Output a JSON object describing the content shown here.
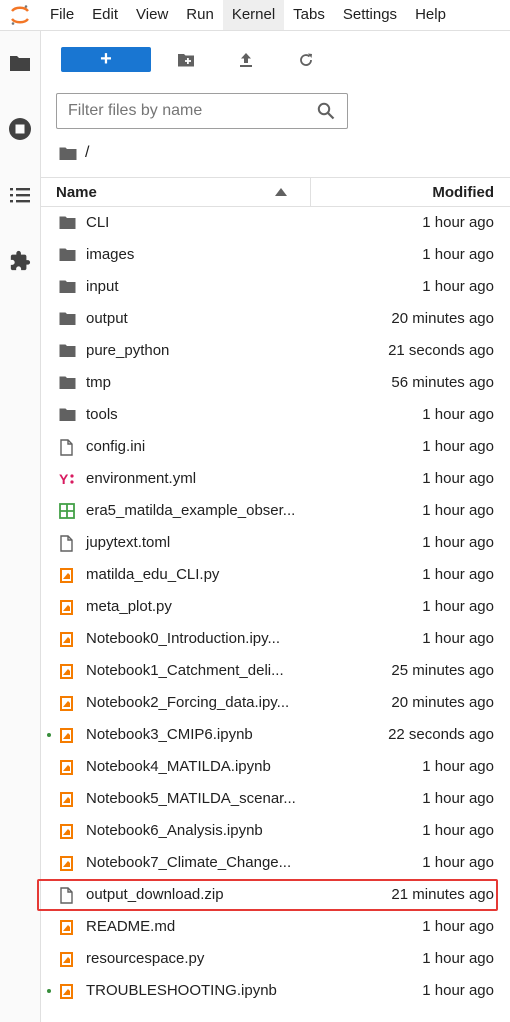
{
  "menubar": {
    "items": [
      "File",
      "Edit",
      "View",
      "Run",
      "Kernel",
      "Tabs",
      "Settings",
      "Help"
    ],
    "active": "Kernel"
  },
  "sidebar": {
    "tabs": [
      "folder-icon",
      "running-icon",
      "toc-icon",
      "extension-icon"
    ]
  },
  "toolbar": {
    "new_label": "+",
    "new_folder_icon": "new-folder-icon",
    "upload_icon": "upload-icon",
    "refresh_icon": "refresh-icon"
  },
  "filter": {
    "placeholder": "Filter files by name",
    "value": ""
  },
  "breadcrumb": {
    "path": "/"
  },
  "columns": {
    "name": "Name",
    "modified": "Modified"
  },
  "colors": {
    "accent": "#1976d2",
    "folder": "#616161",
    "notebook": "#f57c00",
    "yaml": "#d81b60",
    "csv": "#43a047",
    "highlight": "#e53935",
    "running": "#388e3c"
  },
  "files": [
    {
      "name": "CLI",
      "modified": "1 hour ago",
      "type": "folder"
    },
    {
      "name": "images",
      "modified": "1 hour ago",
      "type": "folder"
    },
    {
      "name": "input",
      "modified": "1 hour ago",
      "type": "folder"
    },
    {
      "name": "output",
      "modified": "20 minutes ago",
      "type": "folder"
    },
    {
      "name": "pure_python",
      "modified": "21 seconds ago",
      "type": "folder"
    },
    {
      "name": "tmp",
      "modified": "56 minutes ago",
      "type": "folder"
    },
    {
      "name": "tools",
      "modified": "1 hour ago",
      "type": "folder"
    },
    {
      "name": "config.ini",
      "modified": "1 hour ago",
      "type": "file"
    },
    {
      "name": "environment.yml",
      "modified": "1 hour ago",
      "type": "yaml"
    },
    {
      "name": "era5_matilda_example_obser...",
      "modified": "1 hour ago",
      "type": "csv"
    },
    {
      "name": "jupytext.toml",
      "modified": "1 hour ago",
      "type": "file"
    },
    {
      "name": "matilda_edu_CLI.py",
      "modified": "1 hour ago",
      "type": "python"
    },
    {
      "name": "meta_plot.py",
      "modified": "1 hour ago",
      "type": "python"
    },
    {
      "name": "Notebook0_Introduction.ipy...",
      "modified": "1 hour ago",
      "type": "notebook"
    },
    {
      "name": "Notebook1_Catchment_deli...",
      "modified": "25 minutes ago",
      "type": "notebook"
    },
    {
      "name": "Notebook2_Forcing_data.ipy...",
      "modified": "20 minutes ago",
      "type": "notebook"
    },
    {
      "name": "Notebook3_CMIP6.ipynb",
      "modified": "22 seconds ago",
      "type": "notebook",
      "running": true
    },
    {
      "name": "Notebook4_MATILDA.ipynb",
      "modified": "1 hour ago",
      "type": "notebook"
    },
    {
      "name": "Notebook5_MATILDA_scenar...",
      "modified": "1 hour ago",
      "type": "notebook"
    },
    {
      "name": "Notebook6_Analysis.ipynb",
      "modified": "1 hour ago",
      "type": "notebook"
    },
    {
      "name": "Notebook7_Climate_Change...",
      "modified": "1 hour ago",
      "type": "notebook"
    },
    {
      "name": "output_download.zip",
      "modified": "21 minutes ago",
      "type": "file",
      "highlighted": true
    },
    {
      "name": "README.md",
      "modified": "1 hour ago",
      "type": "markdown"
    },
    {
      "name": "resourcespace.py",
      "modified": "1 hour ago",
      "type": "python"
    },
    {
      "name": "TROUBLESHOOTING.ipynb",
      "modified": "1 hour ago",
      "type": "notebook",
      "running": true
    }
  ]
}
